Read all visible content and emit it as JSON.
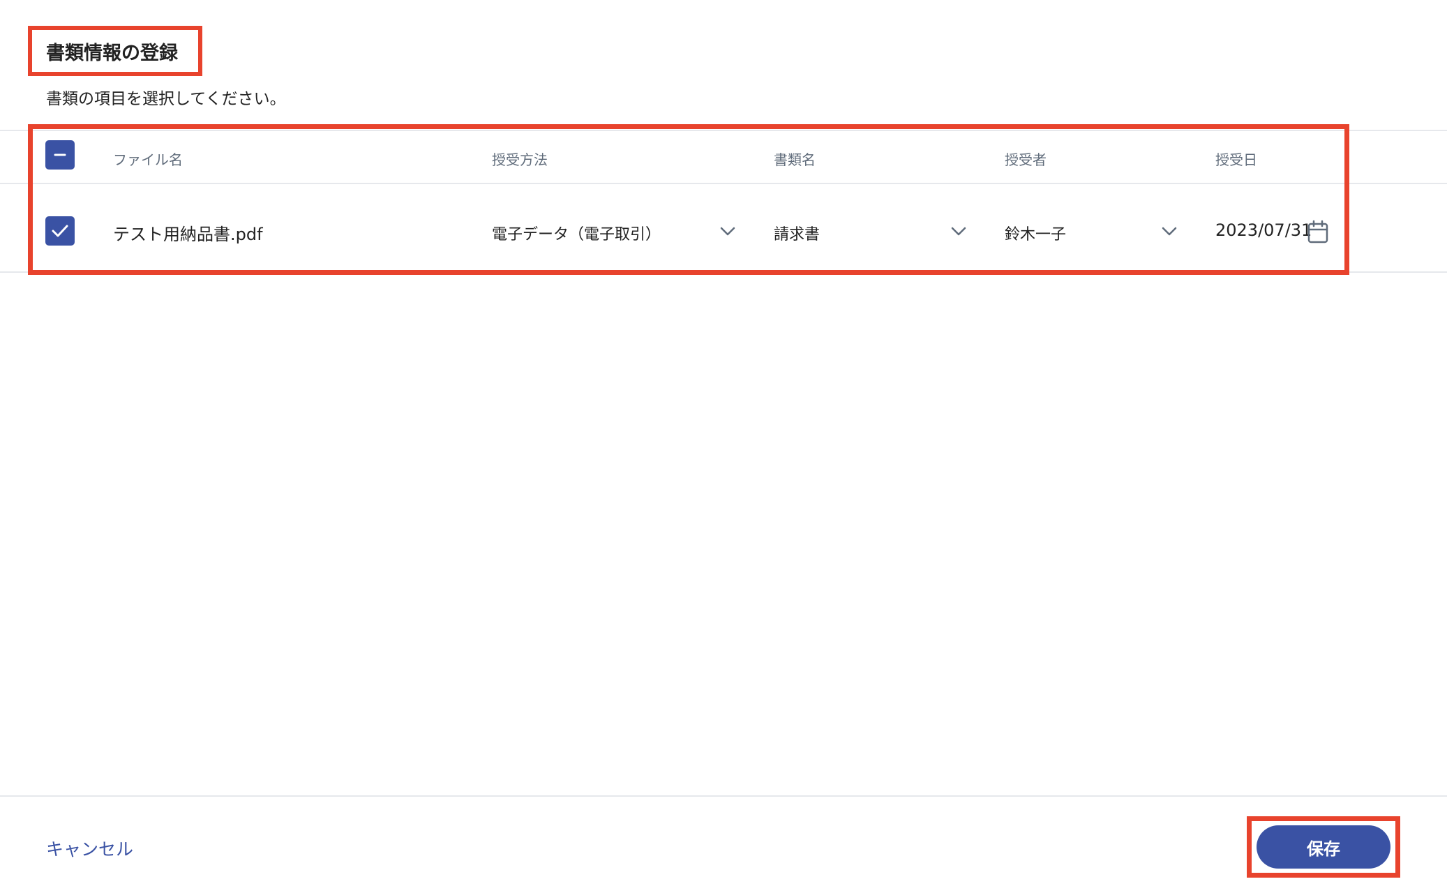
{
  "header": {
    "title": "書類情報の登録",
    "subtitle": "書類の項目を選択してください。"
  },
  "table": {
    "columns": [
      "ファイル名",
      "授受方法",
      "書類名",
      "授受者",
      "授受日"
    ],
    "rows": [
      {
        "file_name": "テスト用納品書.pdf",
        "transfer_method": "電子データ（電子取引）",
        "document_name": "請求書",
        "recipient": "鈴木一子",
        "transfer_date": "2023/07/31"
      }
    ]
  },
  "footer": {
    "cancel_label": "キャンセル",
    "save_label": "保存"
  },
  "colors": {
    "accent": "#3a52a4",
    "highlight": "#e8432d",
    "divider": "#e6e8ec"
  }
}
